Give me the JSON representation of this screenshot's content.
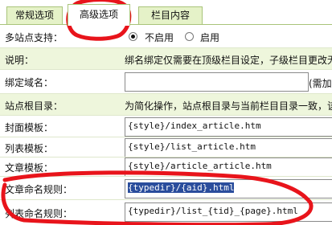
{
  "tabs": [
    {
      "label": "常规选项"
    },
    {
      "label": "高级选项"
    },
    {
      "label": "栏目内容"
    }
  ],
  "multisite": {
    "label": "多站点支持：",
    "options": [
      {
        "label": "不启用",
        "checked": true
      },
      {
        "label": "启用",
        "checked": false
      }
    ]
  },
  "desc": {
    "label": "说明：",
    "text": "绑名绑定仅需要在顶级栏目设定，子级栏目更改无"
  },
  "domain": {
    "label": "绑定域名：",
    "value": "",
    "hint": "(需加"
  },
  "siteroot": {
    "label": "站点根目录：",
    "text": "为简化操作，站点根目录与当前栏目目录一致，该"
  },
  "cover_tpl": {
    "label": "封面模板：",
    "value": "{style}/index_article.htm"
  },
  "list_tpl": {
    "label": "列表模板：",
    "value": "{style}/list_article.htm"
  },
  "article_tpl": {
    "label": "文章模板：",
    "value": "{style}/article_article.htm"
  },
  "article_rule": {
    "label": "文章命名规则：",
    "value": "{typedir}/{aid}.html"
  },
  "list_rule": {
    "label": "列表命名规则：",
    "value": "{typedir}/list_{tid}_{page}.html"
  },
  "colors": {
    "tab_bg": "#e5f2c8",
    "row_green": "#eef6dc",
    "annotation": "#e8141b",
    "selection": "#2a4d9c"
  }
}
